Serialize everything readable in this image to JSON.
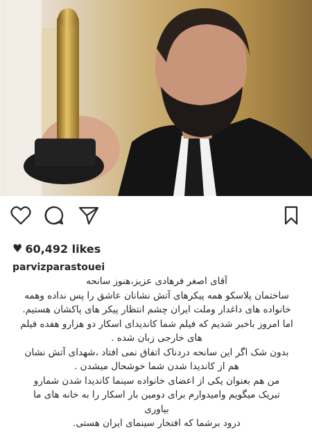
{
  "post": {
    "image_description_icon": "photo-icon",
    "likes_icon": "heart-icon",
    "likes_text": "60,492 likes",
    "username": "parvizparastouei",
    "caption_lines": [
      "آقای اصغر فرهادی عزیز،هنوز سانحه",
      "ساختمان پلاسکو همه پیکرهای آتش نشانان  عاشق را پس نداده وهمه",
      "خانواده های داغدار وملت ایران چشم انتظار پیکر های پاکشان هستیم.",
      "اما امروز باخبر شدیم که فیلم شما کاندیدای اسکار دو هزارو هفده فیلم",
      "های خارجی زبان شده .",
      "بدون شک اگر این سانحه دردناک اتفاق نمی افتاد ،شهدای  آتش نشان",
      "هم از کاندیدا شدن شما خوشحال میشدن .",
      "من هم بعنوان یکی از اعضای خانواده سینما کاندیدا شدن شمارو",
      "تبریک میگویم وامیدوارم برای دومین بار اسکار را به خانه های ما",
      "بیاوری",
      "درود برشما که افتخار سینمای ایران هستی."
    ]
  },
  "actions": {
    "like_icon": "heart-outline-icon",
    "comment_icon": "comment-icon",
    "share_icon": "paper-plane-icon",
    "save_icon": "bookmark-icon"
  },
  "colors": {
    "text": "#262626",
    "background": "#ffffff"
  }
}
